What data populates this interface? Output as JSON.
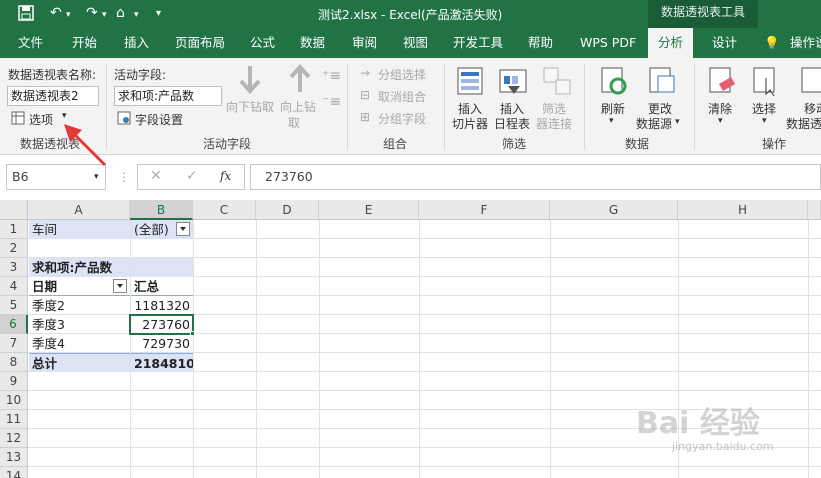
{
  "window": {
    "title": "测试2.xlsx  -  Excel(产品激活失败)",
    "context_tab_group": "数据透视表工具"
  },
  "ribbon_tabs": [
    "文件",
    "开始",
    "插入",
    "页面布局",
    "公式",
    "数据",
    "审阅",
    "视图",
    "开发工具",
    "帮助",
    "WPS PDF",
    "分析",
    "设计",
    "操作说"
  ],
  "ribbon": {
    "pivot_name_label": "数据透视表名称:",
    "pivot_name_value": "数据透视表2",
    "options_label": "选项",
    "group_pivot": "数据透视表",
    "active_field_label": "活动字段:",
    "active_field_value": "求和项:产品数",
    "field_settings": "字段设置",
    "drill_down": "向下钻取",
    "drill_up": "向上钻",
    "drill_up_2": "取",
    "group_active_field": "活动字段",
    "group_selection": "分组选择",
    "ungroup": "取消组合",
    "group_field": "分组字段",
    "group_group": "组合",
    "insert_slicer_1": "插入",
    "insert_slicer_2": "切片器",
    "insert_timeline_1": "插入",
    "insert_timeline_2": "日程表",
    "filter_conn_1": "筛选",
    "filter_conn_2": "器连接",
    "group_filter": "筛选",
    "refresh": "刷新",
    "change_source_1": "更改",
    "change_source_2": "数据源",
    "group_data": "数据",
    "clear": "清除",
    "select": "选择",
    "move_1": "移动",
    "move_2": "数据透",
    "group_actions": "操作"
  },
  "formula_bar": {
    "name_box": "B6",
    "fx": "fx",
    "formula": "273760"
  },
  "sheet": {
    "columns": [
      "A",
      "B",
      "C",
      "D",
      "E",
      "F",
      "G",
      "H"
    ],
    "rows": [
      "1",
      "2",
      "3",
      "4",
      "5",
      "6",
      "7",
      "8",
      "9",
      "10",
      "11",
      "12",
      "13",
      "14"
    ],
    "cells": {
      "A1": "车间",
      "B1": "(全部)",
      "A3": "求和项:产品数",
      "A4": "日期",
      "B4": "汇总",
      "A5": "季度2",
      "B5": "1181320",
      "A6": "季度3",
      "B6": "273760",
      "A7": "季度4",
      "B7": "729730",
      "A8": "总计",
      "B8": "2184810"
    }
  },
  "watermark": {
    "text": "Bai 经验",
    "sub": "jingyan.baidu.com"
  },
  "colors": {
    "excel_green": "#217346",
    "pivot_blue": "#dce3f5",
    "annotation_red": "#e53935"
  }
}
